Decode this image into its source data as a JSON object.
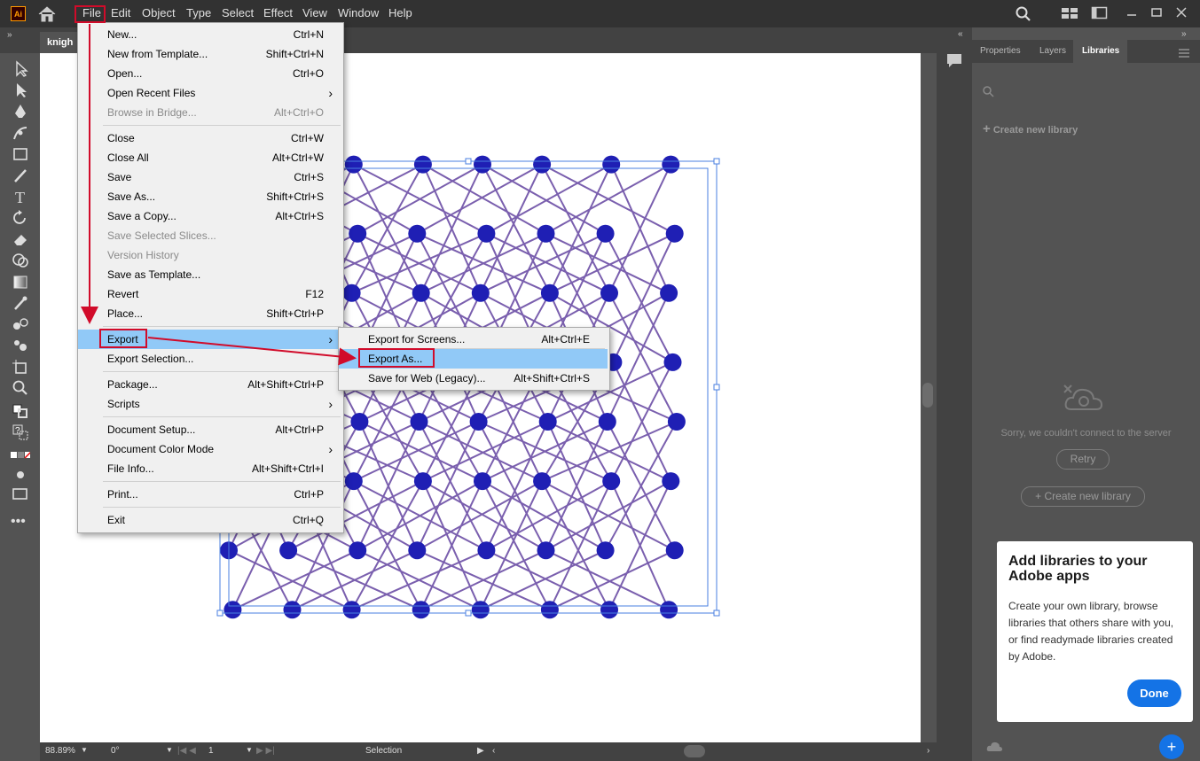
{
  "app": {
    "logo": "Ai"
  },
  "menubar": {
    "items": [
      "File",
      "Edit",
      "Object",
      "Type",
      "Select",
      "Effect",
      "View",
      "Window",
      "Help"
    ]
  },
  "doc_tab": {
    "label": "knigh"
  },
  "file_menu": {
    "items": [
      {
        "label": "New...",
        "shortcut": "Ctrl+N",
        "disabled": false,
        "submenu": false
      },
      {
        "label": "New from Template...",
        "shortcut": "Shift+Ctrl+N",
        "disabled": false,
        "submenu": false
      },
      {
        "label": "Open...",
        "shortcut": "Ctrl+O",
        "disabled": false,
        "submenu": false
      },
      {
        "label": "Open Recent Files",
        "shortcut": "",
        "disabled": false,
        "submenu": true
      },
      {
        "label": "Browse in Bridge...",
        "shortcut": "Alt+Ctrl+O",
        "disabled": true,
        "submenu": false
      },
      {
        "label": "Close",
        "shortcut": "Ctrl+W",
        "disabled": false,
        "submenu": false
      },
      {
        "label": "Close All",
        "shortcut": "Alt+Ctrl+W",
        "disabled": false,
        "submenu": false
      },
      {
        "label": "Save",
        "shortcut": "Ctrl+S",
        "disabled": false,
        "submenu": false
      },
      {
        "label": "Save As...",
        "shortcut": "Shift+Ctrl+S",
        "disabled": false,
        "submenu": false
      },
      {
        "label": "Save a Copy...",
        "shortcut": "Alt+Ctrl+S",
        "disabled": false,
        "submenu": false
      },
      {
        "label": "Save Selected Slices...",
        "shortcut": "",
        "disabled": true,
        "submenu": false
      },
      {
        "label": "Version History",
        "shortcut": "",
        "disabled": true,
        "submenu": false
      },
      {
        "label": "Save as Template...",
        "shortcut": "",
        "disabled": false,
        "submenu": false
      },
      {
        "label": "Revert",
        "shortcut": "F12",
        "disabled": false,
        "submenu": false
      },
      {
        "label": "Place...",
        "shortcut": "Shift+Ctrl+P",
        "disabled": false,
        "submenu": false
      },
      {
        "label": "Export",
        "shortcut": "",
        "disabled": false,
        "submenu": true
      },
      {
        "label": "Export Selection...",
        "shortcut": "",
        "disabled": false,
        "submenu": false
      },
      {
        "label": "Package...",
        "shortcut": "Alt+Shift+Ctrl+P",
        "disabled": false,
        "submenu": false
      },
      {
        "label": "Scripts",
        "shortcut": "",
        "disabled": false,
        "submenu": true
      },
      {
        "label": "Document Setup...",
        "shortcut": "Alt+Ctrl+P",
        "disabled": false,
        "submenu": false
      },
      {
        "label": "Document Color Mode",
        "shortcut": "",
        "disabled": false,
        "submenu": true
      },
      {
        "label": "File Info...",
        "shortcut": "Alt+Shift+Ctrl+I",
        "disabled": false,
        "submenu": false
      },
      {
        "label": "Print...",
        "shortcut": "Ctrl+P",
        "disabled": false,
        "submenu": false
      },
      {
        "label": "Exit",
        "shortcut": "Ctrl+Q",
        "disabled": false,
        "submenu": false
      }
    ]
  },
  "export_submenu": {
    "items": [
      {
        "label": "Export for Screens...",
        "shortcut": "Alt+Ctrl+E"
      },
      {
        "label": "Export As...",
        "shortcut": ""
      },
      {
        "label": "Save for Web (Legacy)...",
        "shortcut": "Alt+Shift+Ctrl+S"
      }
    ]
  },
  "panel": {
    "tabs": [
      "Properties",
      "Layers",
      "Libraries"
    ],
    "active_tab": "Libraries",
    "create_link": "Create new library",
    "error_text": "Sorry, we couldn't connect to the server",
    "retry_label": "Retry",
    "create_button": "+ Create new library"
  },
  "popup": {
    "title": "Add libraries to your Adobe apps",
    "body": "Create your own library, browse libraries that others share with you, or find readymade libraries created by Adobe.",
    "done_label": "Done"
  },
  "statusbar": {
    "zoom": "88.89%",
    "rotation": "0°",
    "artboard": "1",
    "tool": "Selection"
  },
  "colors": {
    "accent_red": "#d10b2a",
    "highlight": "#91c9f7",
    "dot": "#1f1fb4",
    "line": "#7a5fae",
    "done_button": "#1473e6"
  }
}
